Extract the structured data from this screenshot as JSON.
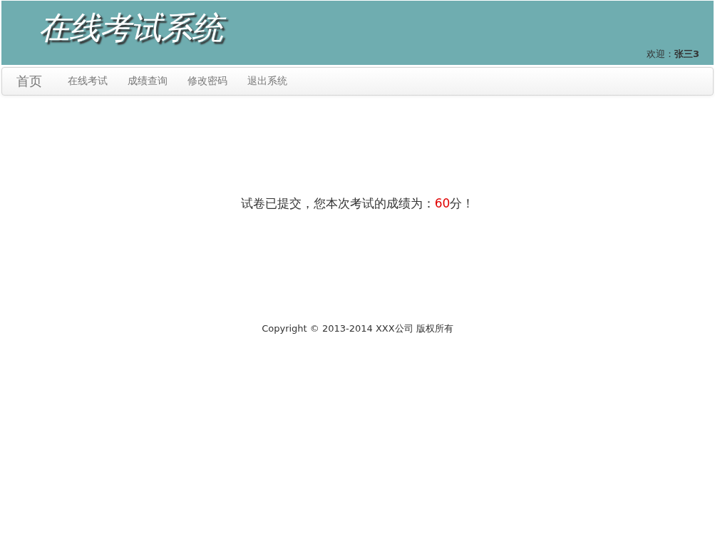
{
  "header": {
    "title": "在线考试系统",
    "welcome": "欢迎：**张三3**"
  },
  "navbar": {
    "brand": "首页",
    "items": [
      {
        "label": "在线考试"
      },
      {
        "label": "成绩查询"
      },
      {
        "label": "修改密码"
      },
      {
        "label": "退出系统"
      }
    ]
  },
  "result": {
    "before": "试卷已提交，您本次考试的成绩为：",
    "score": "60",
    "after": "分！"
  },
  "footer": {
    "copyright": "Copyright © 2013-2014 XXX公司 版权所有"
  }
}
